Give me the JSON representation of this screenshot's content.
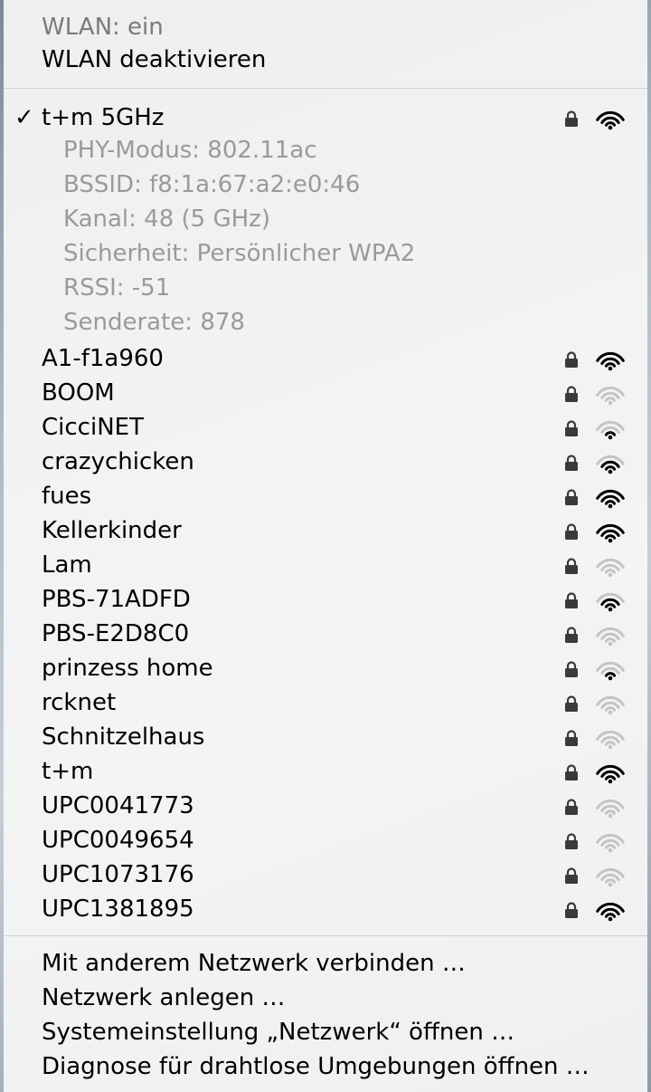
{
  "header": {
    "status": "WLAN: ein",
    "toggle": "WLAN deaktivieren"
  },
  "current": {
    "name": "t+m 5GHz",
    "checkmark": "✓",
    "details": [
      "PHY-Modus: 802.11ac",
      "BSSID: f8:1a:67:a2:e0:46",
      "Kanal: 48 (5 GHz)",
      "Sicherheit: Persönlicher WPA2",
      "RSSI: -51",
      "Senderate: 878"
    ],
    "locked": true,
    "signal_bars": 3
  },
  "networks": [
    {
      "name": "A1-f1a960",
      "locked": true,
      "signal_bars": 3
    },
    {
      "name": "BOOM",
      "locked": true,
      "signal_bars": 0
    },
    {
      "name": "CicciNET",
      "locked": true,
      "signal_bars": 1
    },
    {
      "name": "crazychicken",
      "locked": true,
      "signal_bars": 2
    },
    {
      "name": "fues",
      "locked": true,
      "signal_bars": 3
    },
    {
      "name": "Kellerkinder",
      "locked": true,
      "signal_bars": 3
    },
    {
      "name": "Lam",
      "locked": true,
      "signal_bars": 0
    },
    {
      "name": "PBS-71ADFD",
      "locked": true,
      "signal_bars": 2
    },
    {
      "name": "PBS-E2D8C0",
      "locked": true,
      "signal_bars": 0
    },
    {
      "name": "prinzess home",
      "locked": true,
      "signal_bars": 1
    },
    {
      "name": "rcknet",
      "locked": true,
      "signal_bars": 0
    },
    {
      "name": "Schnitzelhaus",
      "locked": true,
      "signal_bars": 0
    },
    {
      "name": "t+m",
      "locked": true,
      "signal_bars": 3
    },
    {
      "name": "UPC0041773",
      "locked": true,
      "signal_bars": 0
    },
    {
      "name": "UPC0049654",
      "locked": true,
      "signal_bars": 0
    },
    {
      "name": "UPC1073176",
      "locked": true,
      "signal_bars": 0
    },
    {
      "name": "UPC1381895",
      "locked": true,
      "signal_bars": 3
    }
  ],
  "footer": [
    "Mit anderem Netzwerk verbinden …",
    "Netzwerk anlegen …",
    "Systemeinstellung „Netzwerk“ öffnen …",
    "Diagnose für drahtlose Umgebungen öffnen …"
  ],
  "colors": {
    "icon_strong": "#000000",
    "icon_weak": "#c4c4c4",
    "detail_text": "#9a9a9a"
  }
}
